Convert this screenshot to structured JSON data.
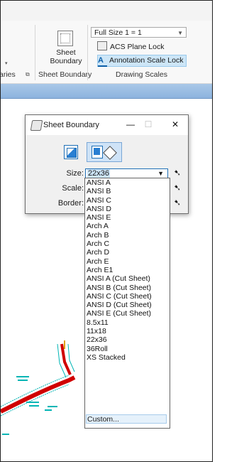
{
  "ribbon": {
    "partial_group_label": "aries",
    "sheet_boundary_button": [
      "Sheet",
      "Boundary"
    ],
    "sheet_boundary_group_label": "Sheet Boundary",
    "drawing_scale_value": "Full Size 1 = 1",
    "acs_plane_lock_label": "ACS Plane Lock",
    "annotation_scale_lock_label": "Annotation Scale Lock",
    "drawing_scales_group_label": "Drawing Scales"
  },
  "dialog": {
    "title": "Sheet Boundary",
    "minimize": "—",
    "maximize": "☐",
    "close": "✕",
    "size_label": "Size:",
    "size_value": "22x36",
    "scale_label": "Scale:",
    "border_label": "Border:"
  },
  "size_options": [
    "ANSI A",
    "ANSI B",
    "ANSI C",
    "ANSI D",
    "ANSI E",
    "Arch A",
    "Arch B",
    "Arch C",
    "Arch D",
    "Arch E",
    "Arch E1",
    "ANSI A (Cut Sheet)",
    "ANSI B (Cut Sheet)",
    "ANSI C (Cut Sheet)",
    "ANSI D (Cut Sheet)",
    "ANSI E (Cut Sheet)",
    "8.5x11",
    "11x18",
    "22x36",
    "36Roll",
    "XS Stacked"
  ],
  "custom_option": "Custom...",
  "icons": {
    "sheet_boundary": "sheet-boundary-icon",
    "dialog": "sheet-boundary-dialog-icon",
    "pick": "pick-arrow-icon"
  }
}
